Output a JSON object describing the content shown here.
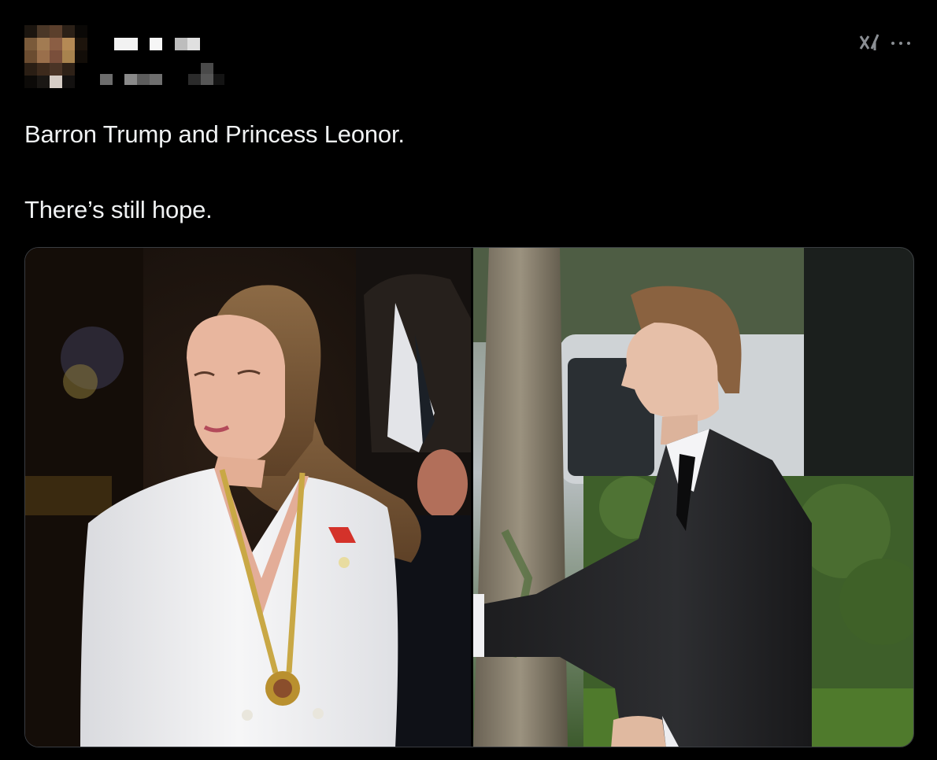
{
  "post": {
    "author": {
      "avatar_icon": "pixelated-avatar",
      "display_name_redacted": true,
      "handle_redacted": true
    },
    "actions": {
      "grok_icon": "grok-icon",
      "more_icon": "more-icon"
    },
    "text": {
      "line1": "Barron Trump and Princess Leonor.",
      "line2": "There’s still hope."
    },
    "media": {
      "count": 2,
      "images": [
        {
          "icon": "photo-princess-white-suit"
        },
        {
          "icon": "photo-young-man-black-suit"
        }
      ]
    }
  },
  "colors": {
    "background": "#000000",
    "text": "#e7e9ea",
    "icon": "#8b8f94",
    "media_border": "#3a3d42"
  }
}
